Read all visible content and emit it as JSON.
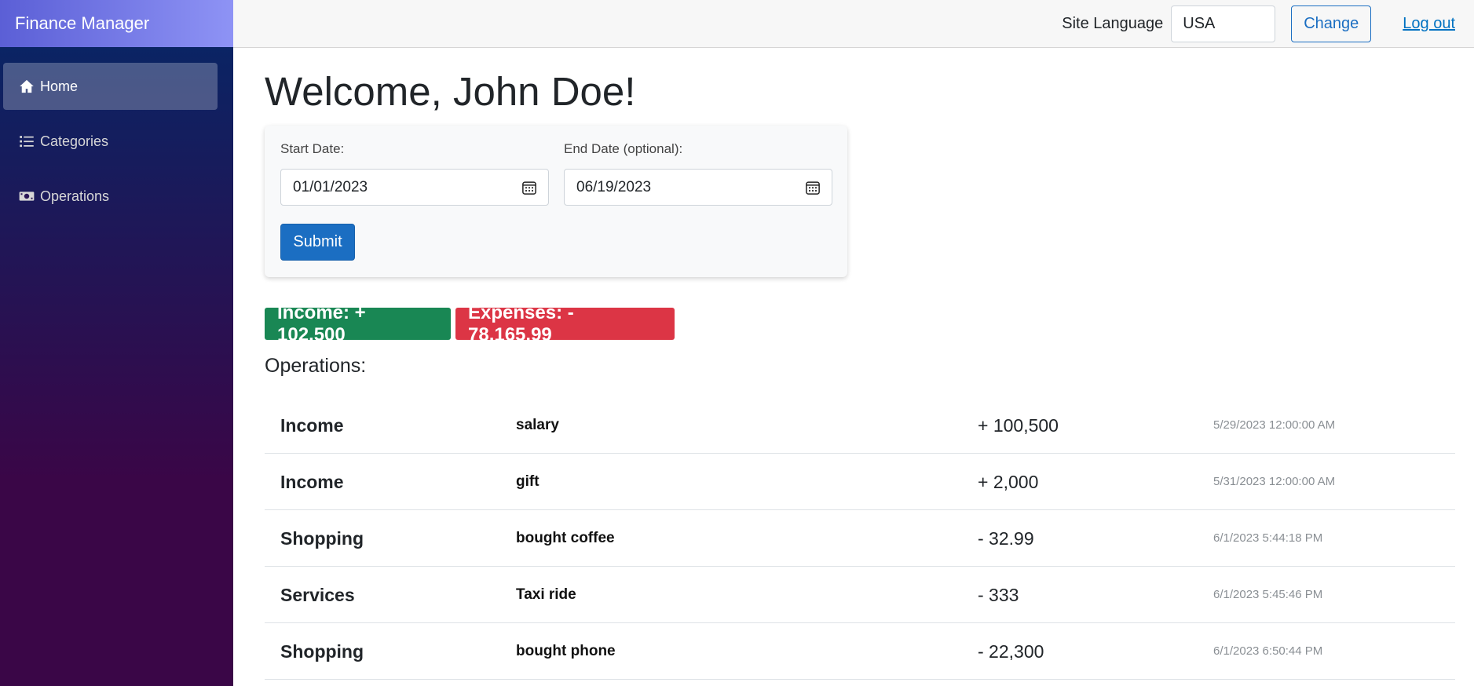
{
  "app": {
    "brand": "Finance Manager"
  },
  "sidebar": {
    "items": [
      {
        "label": "Home",
        "icon": "home-icon",
        "active": true
      },
      {
        "label": "Categories",
        "icon": "list-icon",
        "active": false
      },
      {
        "label": "Operations",
        "icon": "money-icon",
        "active": false
      }
    ]
  },
  "topbar": {
    "language_label": "Site Language",
    "language_value": "USA",
    "change_label": "Change",
    "logout_label": "Log out"
  },
  "main": {
    "welcome": "Welcome, John Doe!",
    "filter": {
      "start_label": "Start Date:",
      "start_value": "01/01/2023",
      "end_label": "End Date (optional):",
      "end_value": "06/19/2023",
      "submit_label": "Submit"
    },
    "income_badge": "Income: + 102,500",
    "expenses_badge": "Expenses: - 78,165.99",
    "operations_heading": "Operations:",
    "operations": [
      {
        "category": "Income",
        "description": "salary",
        "amount": "+ 100,500",
        "date": "5/29/2023 12:00:00 AM"
      },
      {
        "category": "Income",
        "description": "gift",
        "amount": "+ 2,000",
        "date": "5/31/2023 12:00:00 AM"
      },
      {
        "category": "Shopping",
        "description": "bought coffee",
        "amount": "- 32.99",
        "date": "6/1/2023 5:44:18 PM"
      },
      {
        "category": "Services",
        "description": "Taxi ride",
        "amount": "- 333",
        "date": "6/1/2023 5:45:46 PM"
      },
      {
        "category": "Shopping",
        "description": "bought phone",
        "amount": "- 22,300",
        "date": "6/1/2023 6:50:44 PM"
      }
    ]
  },
  "colors": {
    "primary": "#1b6ec2",
    "income": "#198754",
    "expense": "#dc3545",
    "sidebar_top": "#052767",
    "sidebar_bottom": "#3a0647"
  }
}
